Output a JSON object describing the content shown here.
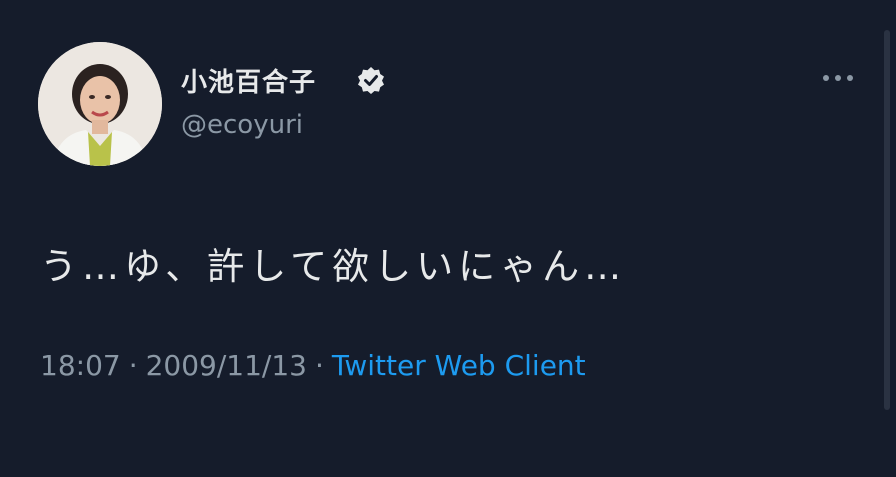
{
  "tweet": {
    "display_name": "小池百合子",
    "handle": "@ecoyuri",
    "verified": true,
    "text": "う…ゆ、許して欲しいにゃん…",
    "time": "18:07",
    "date": "2009/11/13",
    "separator": "·",
    "client": "Twitter Web Client"
  },
  "icons": {
    "verified": "verified-badge-icon",
    "more": "more-options-icon"
  },
  "colors": {
    "background": "#151c2b",
    "text": "#e7e9ea",
    "secondary_text": "#8b98a5",
    "link": "#1d9bf0"
  }
}
